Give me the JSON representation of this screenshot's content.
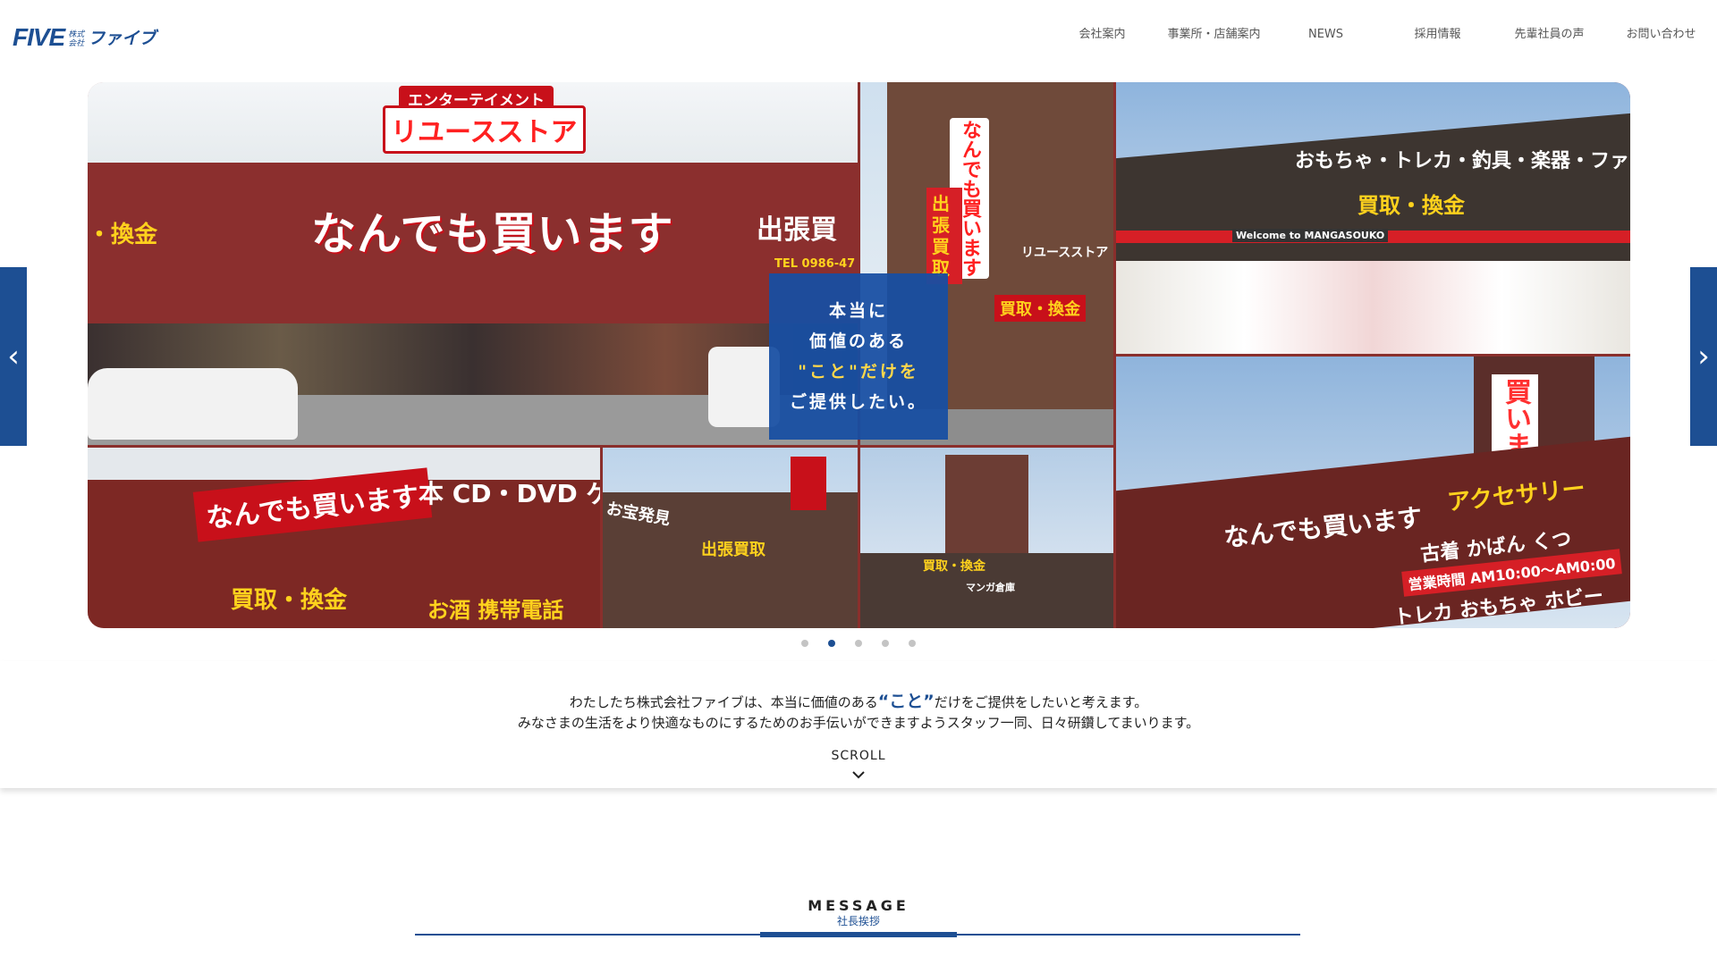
{
  "logo": {
    "mark": "FIVE",
    "small_top": "株式",
    "small_bottom": "会社",
    "kana": "ファイブ"
  },
  "nav": {
    "items": [
      "会社案内",
      "事業所・店舗案内",
      "NEWS",
      "採用情報",
      "先輩社員の声",
      "お問い合わせ"
    ]
  },
  "slider": {
    "copy_lines": [
      "本当に",
      "価値のある",
      "\"こと\"だけを",
      "ご提供したい。"
    ],
    "dots_count": 5,
    "active_dot": 2,
    "photo_text": {
      "p1_top": "エンターテイメント",
      "p1_store": "リユースストア",
      "p1_main": "なんでも買います",
      "p1_side": "出張買",
      "p1_left": "・換金",
      "p1_tel": "TEL 0986-47",
      "p2_main": "なんでも買います",
      "p2_box": "出張買取",
      "p2_store": "リユースストア",
      "p2_buy": "買取・換金",
      "p3_banner": "おもちゃ・トレカ・釣具・楽器・ファッション",
      "p3_buy": "買取・換金",
      "p3_welcome": "Welcome to MANGASOUKO",
      "p4_main": "なんでも買います",
      "p4_cd": "本 CD・DVD ゲ",
      "p4_buy": "買取・換金",
      "p4_bottom": "お酒 携帯電話",
      "p5_top": "お宝発見",
      "p5_main": "出張買取",
      "p6_main": "買取・換金",
      "p6_store": "マンガ倉庫",
      "p7_kanji": "買いますか",
      "p7_access": "アクセサリー",
      "p7_main": "なんでも買います",
      "p7_hours": "営業時間 AM10:00〜AM0:00",
      "p7_bottom": "トレカ おもちゃ ホビー",
      "p7_mid": "古着 かばん くつ"
    }
  },
  "intro": {
    "line1_pre": "わたしたち株式会社ファイブは、本当に価値のある",
    "line1_quote": "“こと”",
    "line1_post": "だけをご提供をしたいと考えます。",
    "line2": "みなさまの生活をより快適なものにするためのお手伝いができますようスタッフ一同、日々研鑽してまいります。",
    "scroll": "SCROLL"
  },
  "message": {
    "title": "MESSAGE",
    "subtitle": "社長挨拶"
  },
  "colors": {
    "brand": "#1d4f93",
    "accent_red": "#d61f26",
    "highlight": "#ffd84a"
  }
}
